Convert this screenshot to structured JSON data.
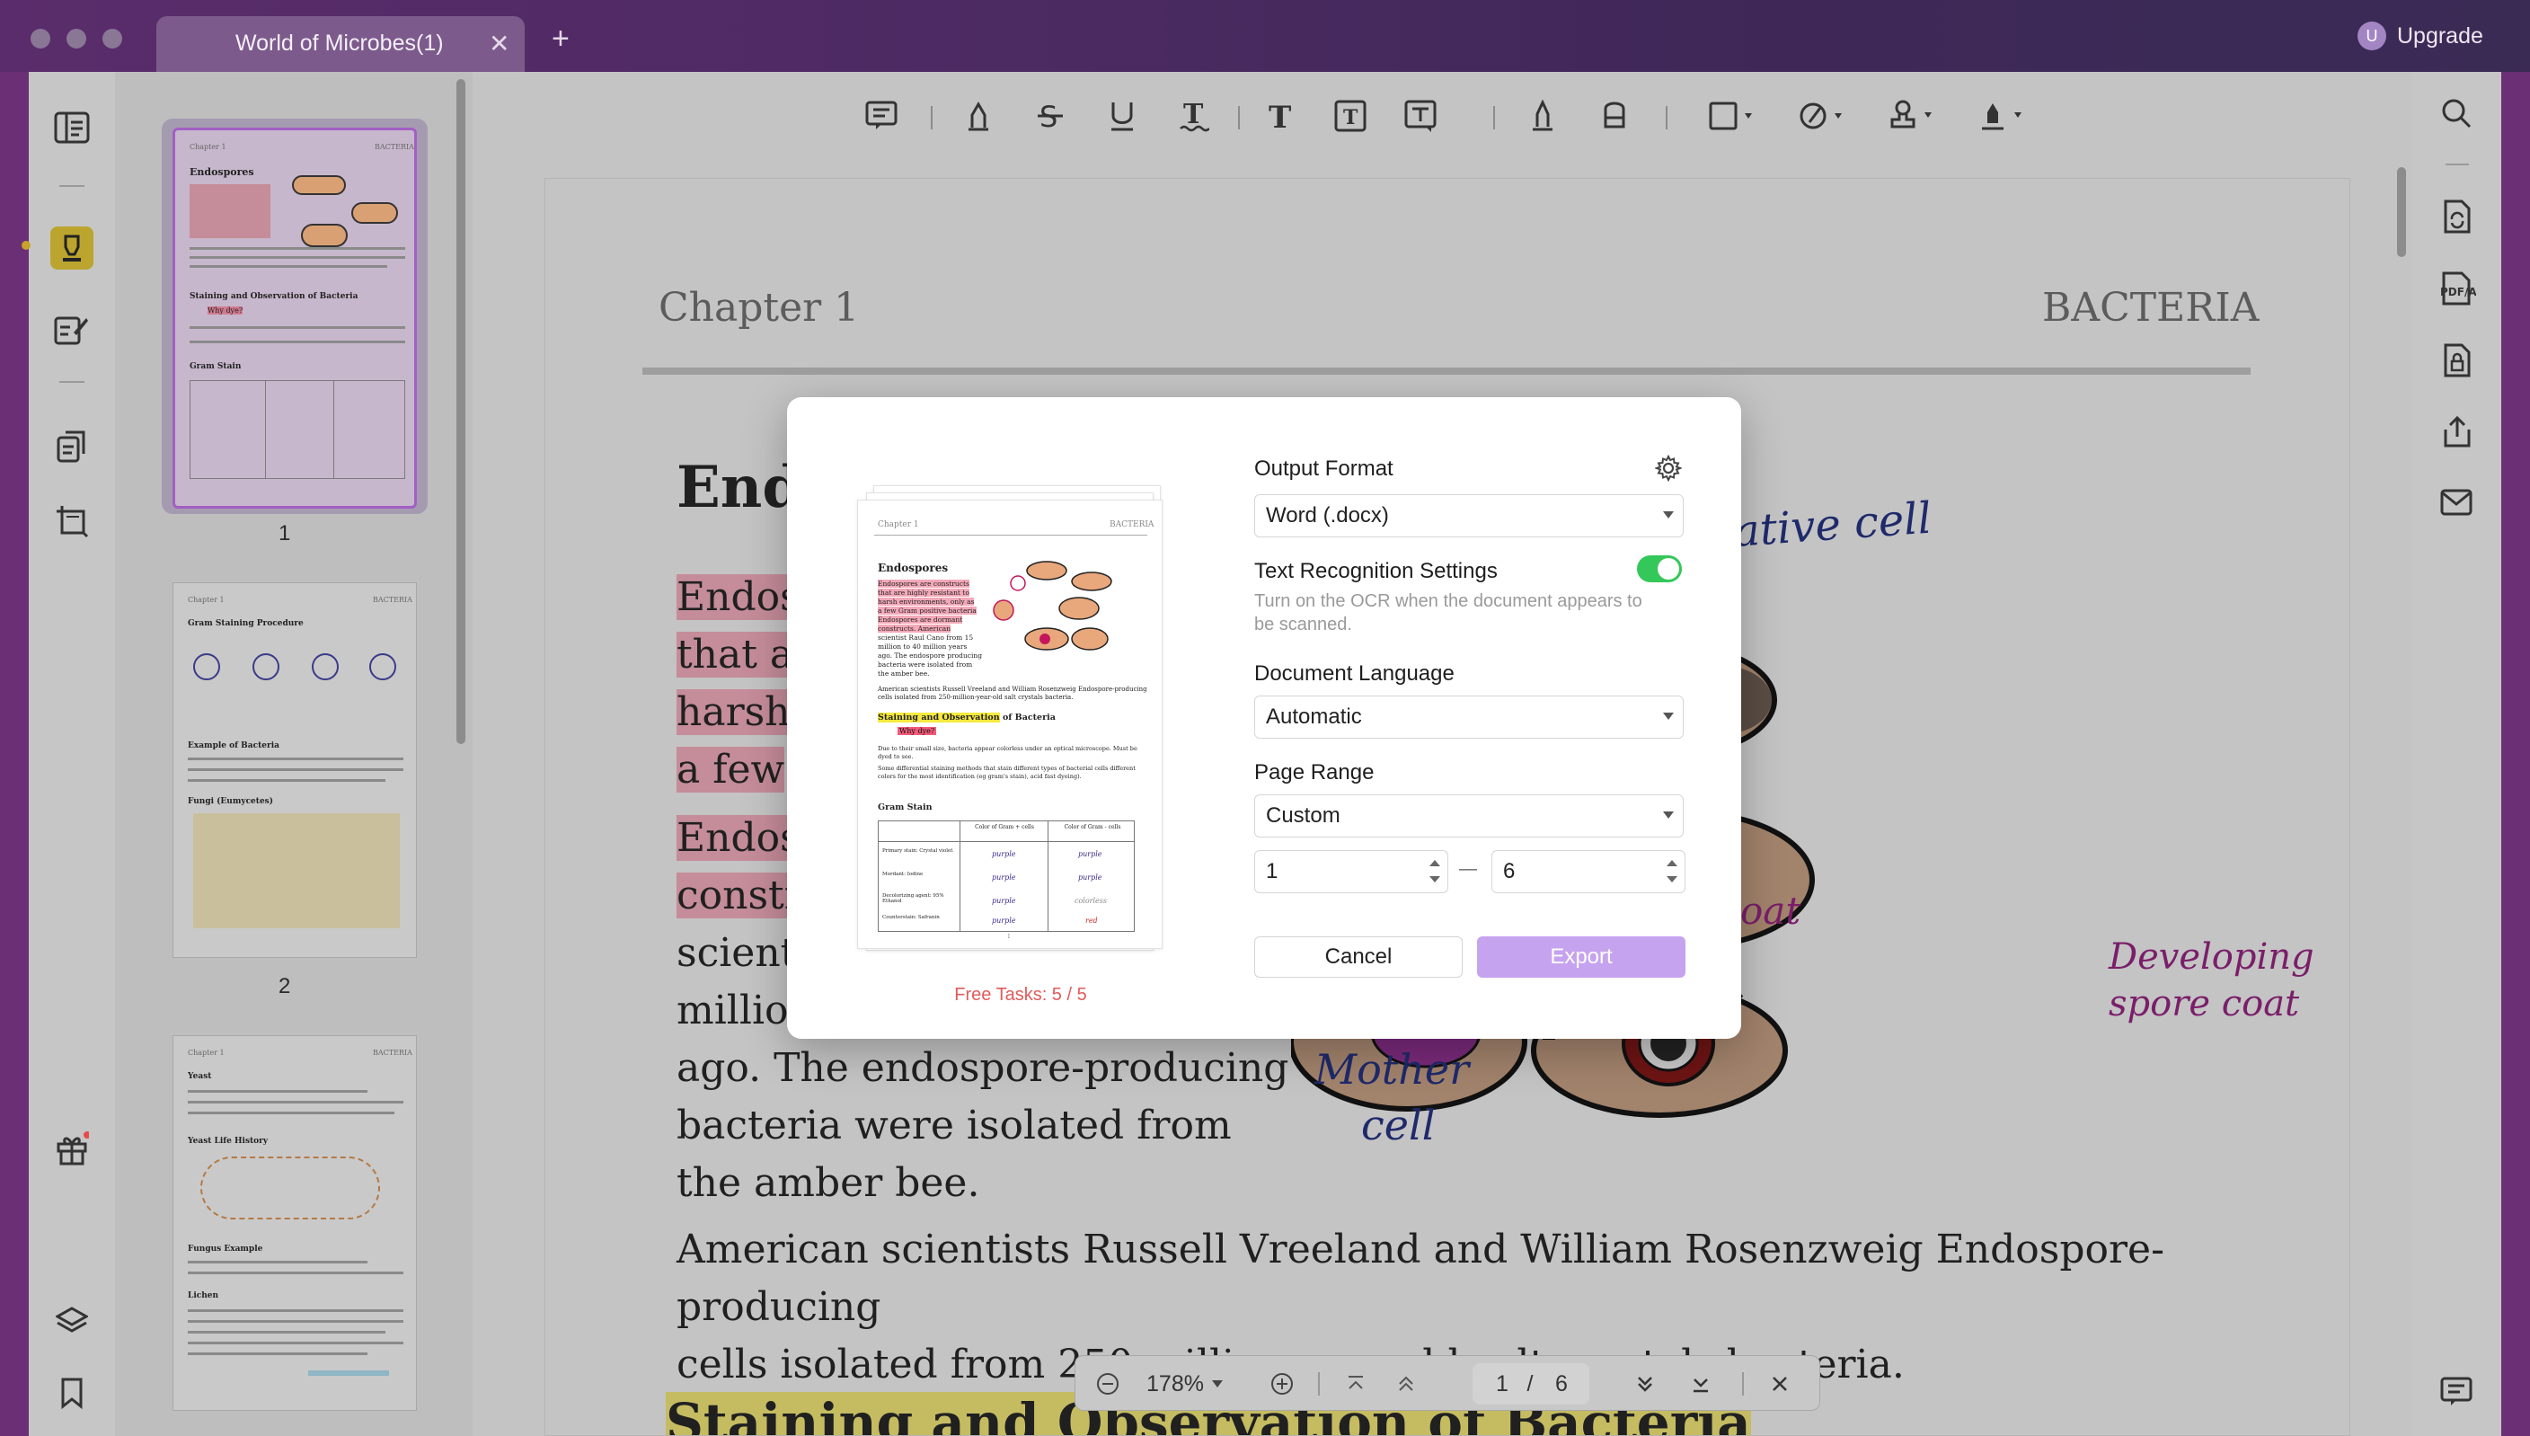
{
  "window": {
    "tab_title": "World of Microbes(1)",
    "tab_close": "✕",
    "new_tab": "+",
    "upgrade": {
      "avatar_letter": "U",
      "label": "Upgrade"
    }
  },
  "thumbnails": {
    "page_numbers": [
      "1",
      "2"
    ],
    "thumb1": {
      "header_left": "Chapter 1",
      "header_right": "BACTERIA",
      "title": "Endospores",
      "subtitle": "Staining and Observation of Bacteria",
      "note": "Why dye?",
      "table_title": "Gram Stain"
    },
    "thumb2": {
      "header_left": "Chapter 1",
      "header_right": "BACTERIA",
      "title": "Gram Staining Procedure",
      "section": "Example of Bacteria",
      "section2": "Fungi  (Eumycetes)"
    },
    "thumb3": {
      "header_left": "Chapter 1",
      "header_right": "BACTERIA",
      "title": "Yeast",
      "section": "Yeast Life History",
      "section2": "Fungus Example",
      "section3": "Lichen"
    }
  },
  "document": {
    "header_left": "Chapter 1",
    "header_right": "BACTERIA",
    "heading_fragment": "End",
    "para1_lines": [
      "Endos",
      "that ar",
      "harsh",
      "a few"
    ],
    "para2_lines": [
      "Endos",
      "constr",
      "scient",
      "millior",
      "ago. The endospore-producing",
      "bacteria were isolated from",
      "the amber bee."
    ],
    "para3_lines": [
      "American scientists Russell Vreeland and William Rosenzweig Endospore-producing",
      "cells isolated from 250-million-year-old salt crystals bacteria."
    ],
    "next_heading": "Staining and Observation of Bacteria",
    "handwriting": {
      "vegetative_cell": "Vegetative cell",
      "coat": "oat",
      "developing_line1": "Developing",
      "developing_line2": "spore coat",
      "mother_line1": "Mother",
      "mother_line2": "cell"
    }
  },
  "page_nav": {
    "zoom": "178%",
    "current_page": "1",
    "separator": "/",
    "total_pages": "6"
  },
  "dialog": {
    "preview": {
      "header_left": "Chapter 1",
      "header_right": "BACTERIA",
      "title": "Endospores",
      "lines_left": [
        "Endospores are constructs",
        "that are highly resistant to",
        "harsh environments, only as",
        "a few Gram positive bacteria",
        "Endospores are dormant",
        "constructs. American",
        "scientist Raul Cano from 15",
        "million to 40 million years",
        "ago. The endospore producing",
        "bacteria were isolated from",
        "the amber bee."
      ],
      "wide_line1": "American scientists Russell Vreeland and William Rosenzweig Endospore-producing",
      "wide_line2": "cells isolated from 250-million-year-old salt crystals bacteria.",
      "staining_hl": "Staining and Observation",
      "staining_rest": " of Bacteria",
      "why_dye": "Why dye?",
      "bullet1": "Due to their small size, bacteria appear colorless under an optical microscope. Must be dyed to see.",
      "bullet2": "Some differential staining methods that stain different types of bacterial cells different colors for the most identification (eg gram's stain), acid fast dyeing).",
      "gram_stain": "Gram Stain",
      "table_headers": [
        "Color of Gram + cells",
        "Color of Gram - cells"
      ],
      "table_rows": [
        {
          "label": "Primary stain: Crystal violet",
          "a": "purple",
          "b": "purple"
        },
        {
          "label": "Mordant: Iodine",
          "a": "purple",
          "b": "purple"
        },
        {
          "label": "Decolorizing agent: 95% Ethanol",
          "a": "purple",
          "b": "colorless"
        },
        {
          "label": "Counterstain: Safranin",
          "a": "purple",
          "b": "red"
        }
      ],
      "page_marker": "1"
    },
    "free_tasks": "Free Tasks: 5 / 5",
    "output_format_label": "Output Format",
    "output_format_value": "Word (.docx)",
    "ocr_label": "Text Recognition Settings",
    "ocr_enabled": true,
    "ocr_hint_line1": "Turn on the OCR when the document appears to",
    "ocr_hint_line2": "be scanned.",
    "language_label": "Document Language",
    "language_value": "Automatic",
    "range_label": "Page Range",
    "range_value": "Custom",
    "range_from": "1",
    "range_dash": "—",
    "range_to": "6",
    "cancel": "Cancel",
    "export": "Export"
  },
  "icons": {
    "left_sidebar": [
      "reader-icon",
      "highlighter-icon",
      "edit-pen-icon",
      "organize-pages-icon",
      "crop-icon",
      "gift-icon",
      "layers-icon",
      "bookmark-icon"
    ],
    "toolbar": [
      "comment-icon",
      "pencil-icon",
      "strikethrough-icon",
      "underline-icon",
      "squiggly-icon",
      "text-icon",
      "textbox-icon",
      "text-callout-icon",
      "pen-icon",
      "eraser-icon",
      "shape-icon",
      "shape-style-icon",
      "stamp-icon",
      "signature-icon"
    ],
    "right_sidebar": [
      "search-icon",
      "convert-icon",
      "pdfa-icon",
      "protect-icon",
      "share-icon",
      "mail-icon",
      "comments-list-icon"
    ]
  },
  "colors": {
    "accent_purple": "#c6a3ef",
    "toggle_green": "#34c759",
    "free_tasks_red": "#e25b5b",
    "highlight_pink": "#c58c99",
    "highlight_yellow": "#c5bc62",
    "handwriting_blue": "#1f2a6b",
    "handwriting_purple": "#7a1e6a"
  }
}
